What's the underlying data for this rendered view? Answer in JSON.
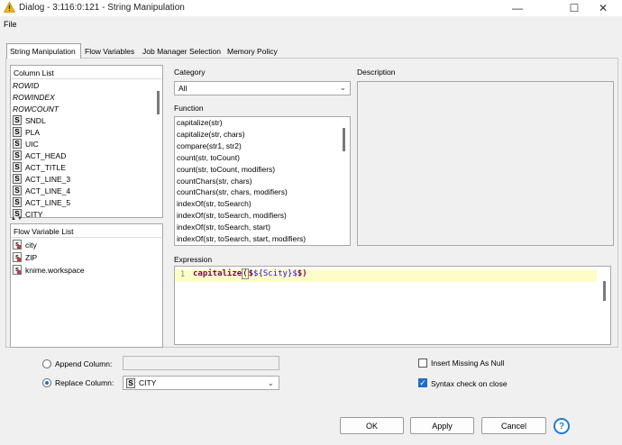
{
  "window": {
    "title": "Dialog - 3:116:0:121 - String Manipulation",
    "minimize_glyph": "—",
    "maximize_glyph": "☐",
    "close_glyph": "✕"
  },
  "menu": {
    "file": "File"
  },
  "tabs": [
    {
      "label": "String Manipulation",
      "active": true
    },
    {
      "label": "Flow Variables",
      "active": false
    },
    {
      "label": "Job Manager Selection",
      "active": false
    },
    {
      "label": "Memory Policy",
      "active": false
    }
  ],
  "column_list": {
    "title": "Column List",
    "items": [
      {
        "label": "ROWID",
        "badge": ""
      },
      {
        "label": "ROWINDEX",
        "badge": ""
      },
      {
        "label": "ROWCOUNT",
        "badge": ""
      },
      {
        "label": "SNDL",
        "badge": "S"
      },
      {
        "label": "PLA",
        "badge": "S"
      },
      {
        "label": "UIC",
        "badge": "S"
      },
      {
        "label": "ACT_HEAD",
        "badge": "S"
      },
      {
        "label": "ACT_TITLE",
        "badge": "S"
      },
      {
        "label": "ACT_LINE_3",
        "badge": "S"
      },
      {
        "label": "ACT_LINE_4",
        "badge": "S"
      },
      {
        "label": "ACT_LINE_5",
        "badge": "S"
      },
      {
        "label": "CITY",
        "badge": "S"
      }
    ]
  },
  "splitter": "▲▼",
  "flow_variable_list": {
    "title": "Flow Variable List",
    "items": [
      {
        "label": "city",
        "badge": "s"
      },
      {
        "label": "ZIP",
        "badge": "s"
      },
      {
        "label": "knime.workspace",
        "badge": "s"
      }
    ]
  },
  "category": {
    "label": "Category",
    "selected": "All",
    "chevron": "⌄"
  },
  "function_list": {
    "label": "Function",
    "items": [
      "capitalize(str)",
      "capitalize(str, chars)",
      "compare(str1, str2)",
      "count(str, toCount)",
      "count(str, toCount, modifiers)",
      "countChars(str, chars)",
      "countChars(str, chars, modifiers)",
      "indexOf(str, toSearch)",
      "indexOf(str, toSearch, modifiers)",
      "indexOf(str, toSearch, start)",
      "indexOf(str, toSearch, start, modifiers)"
    ]
  },
  "description": {
    "label": "Description"
  },
  "expression": {
    "label": "Expression",
    "line_number": "1",
    "func": "capitalize",
    "open_paren": "(",
    "flow_prefix": "$",
    "col_ref": "${Scity}$",
    "tail": "$)"
  },
  "append_column": {
    "label": "Append Column:",
    "value": "",
    "selected": false
  },
  "replace_column": {
    "label": "Replace Column:",
    "badge": "S",
    "value": "CITY",
    "selected": true,
    "chevron": "⌄"
  },
  "insert_missing": {
    "label": "Insert Missing As Null",
    "checked": false
  },
  "syntax_check": {
    "label": "Syntax check on close",
    "checked": true,
    "check_glyph": "✓"
  },
  "buttons": {
    "ok": "OK",
    "apply": "Apply",
    "cancel": "Cancel",
    "help": "?"
  },
  "colors": {
    "accent": "#1f6fc5",
    "expr_highlight": "#fdfdc8",
    "keyword": "#7f0055",
    "column_ref": "#2a00ff"
  }
}
